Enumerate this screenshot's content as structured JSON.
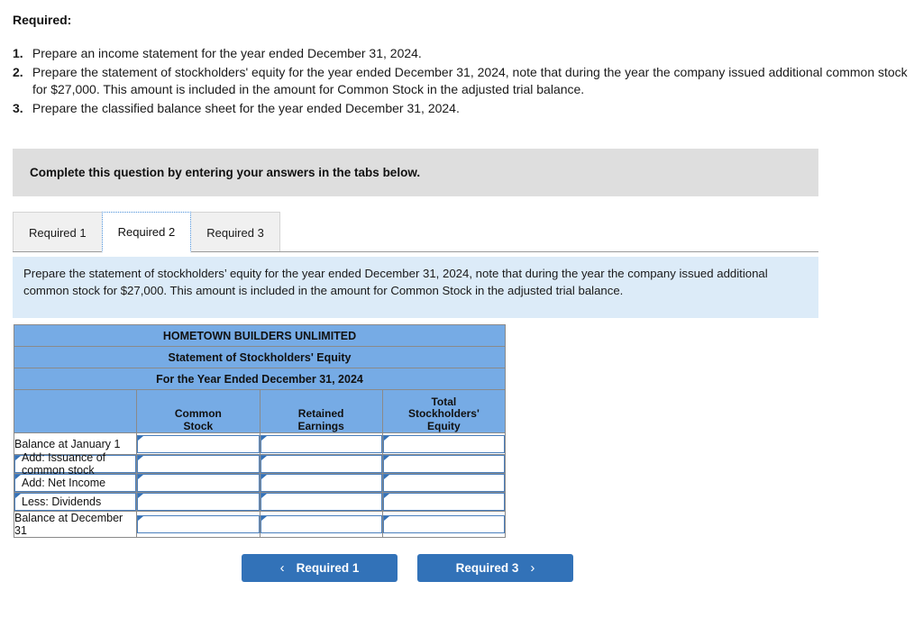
{
  "required": {
    "title": "Required:",
    "items": [
      {
        "num": "1.",
        "text": "Prepare an income statement for the year ended December 31, 2024."
      },
      {
        "num": "2.",
        "text": "Prepare the statement of stockholders' equity for the year ended December 31, 2024, note that during the year the company issued additional common stock for $27,000. This amount is included in the amount for Common Stock in the adjusted trial balance."
      },
      {
        "num": "3.",
        "text": "Prepare the classified balance sheet for the year ended December 31, 2024."
      }
    ]
  },
  "banner": {
    "text": "Complete this question by entering your answers in the tabs below."
  },
  "tabs": [
    {
      "label": "Required 1",
      "active": false
    },
    {
      "label": "Required 2",
      "active": true
    },
    {
      "label": "Required 3",
      "active": false
    }
  ],
  "instruction": {
    "text": "Prepare the statement of stockholders’ equity for the year ended December 31, 2024, note that during the year the company issued additional common stock for $27,000. This amount is included in the amount for Common Stock in the adjusted trial balance."
  },
  "statement": {
    "title_lines": [
      "HOMETOWN BUILDERS UNLIMITED",
      "Statement of Stockholders' Equity",
      "For the Year Ended December 31, 2024"
    ],
    "column_headers": [
      "",
      "Common Stock",
      "Retained Earnings",
      "Total Stockholders' Equity"
    ],
    "rows": [
      {
        "label": "Balance at January 1",
        "label_editable": false,
        "values": [
          "",
          "",
          ""
        ]
      },
      {
        "label": "Add: Issuance of common stock",
        "label_editable": true,
        "values": [
          "",
          "",
          ""
        ]
      },
      {
        "label": "Add: Net Income",
        "label_editable": true,
        "values": [
          "",
          "",
          ""
        ]
      },
      {
        "label": "Less: Dividends",
        "label_editable": true,
        "values": [
          "",
          "",
          ""
        ]
      },
      {
        "label": "Balance at December 31",
        "label_editable": false,
        "values": [
          "",
          "",
          ""
        ]
      }
    ]
  },
  "nav": {
    "prev_label": "Required 1",
    "next_label": "Required 3",
    "prev_icon": "chevron-left-icon",
    "next_icon": "chevron-right-icon",
    "prev_glyph": "‹",
    "next_glyph": "›"
  },
  "colors": {
    "accent_blue": "#3272b8",
    "table_header_blue": "#76abe5",
    "instruction_panel_blue": "#dcebf8",
    "banner_gray": "#dedede",
    "cell_border_blue": "#4a7fbd"
  }
}
